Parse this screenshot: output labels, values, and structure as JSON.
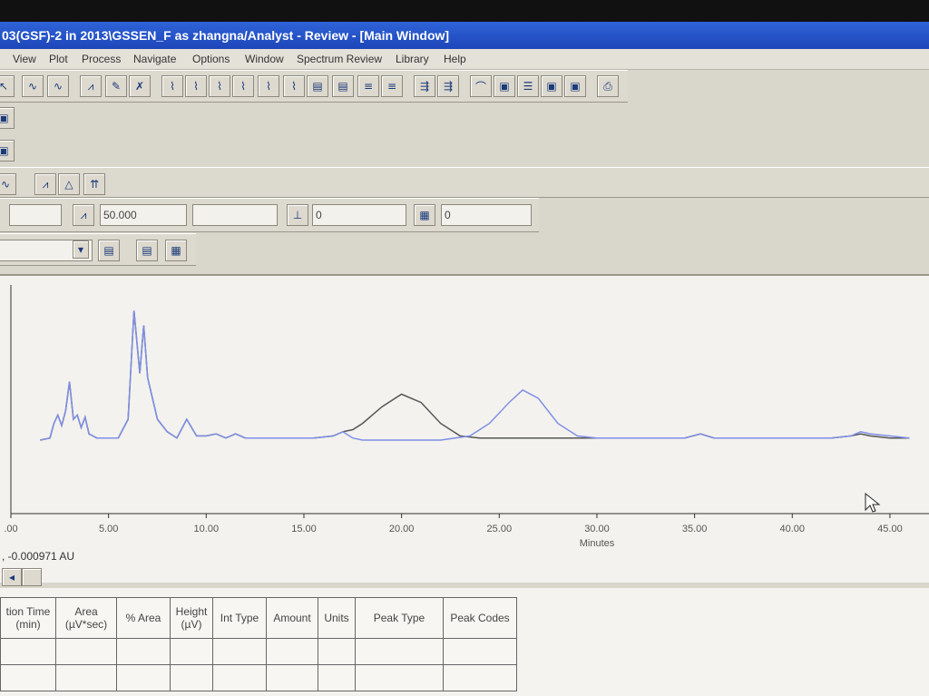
{
  "window": {
    "title": "03(GSF)-2 in 2013\\GSSEN_F as zhangna/Analyst - Review - [Main Window]"
  },
  "menu": [
    "View",
    "Plot",
    "Process",
    "Navigate",
    "Options",
    "Window",
    "Spectrum Review",
    "Library",
    "Help"
  ],
  "toolbar": {
    "icons": [
      "integrate-icon",
      "integrate-all-icon",
      "peak-add-icon",
      "peak-edit-icon",
      "peak-delete-icon",
      "spectrum-1-icon",
      "spectrum-2-icon",
      "spectrum-3-icon",
      "spectrum-4-icon",
      "spectrum-5-icon",
      "spectrum-6-icon",
      "spectrum-7-icon",
      "spectrum-8-icon",
      "spectrum-9-icon",
      "spectrum-10-icon",
      "tool-a-icon",
      "tool-b-icon",
      "view-1-icon",
      "view-2-icon",
      "view-3-icon",
      "view-4-icon",
      "view-5-icon",
      "print-icon"
    ]
  },
  "params": {
    "field1_value": "",
    "threshold_value": "50.000",
    "field3_value": "",
    "min_area_value": "0",
    "min_height_value": "0"
  },
  "plot": {
    "readout": ", -0.000971 AU"
  },
  "chart_data": {
    "type": "line",
    "xlabel": "Minutes",
    "ylabel": "",
    "xlim": [
      0,
      47
    ],
    "x_ticks": [
      ".00",
      "5.00",
      "10.00",
      "15.00",
      "20.00",
      "25.00",
      "30.00",
      "35.00",
      "40.00",
      "45.00"
    ],
    "x_tick_values": [
      0,
      5,
      10,
      15,
      20,
      25,
      30,
      35,
      40,
      45
    ],
    "series": [
      {
        "color": "#555555",
        "x": [
          1.5,
          2.0,
          2.2,
          2.4,
          2.6,
          2.8,
          3.0,
          3.2,
          3.4,
          3.6,
          3.8,
          4.0,
          4.2,
          4.4,
          4.6,
          5.0,
          5.5,
          6.0,
          6.3,
          6.6,
          6.8,
          7.0,
          7.2,
          7.5,
          8.0,
          8.5,
          9.0,
          9.5,
          10.0,
          10.5,
          11.0,
          11.5,
          12.0,
          14.0,
          15.5,
          16.5,
          17.0,
          17.5,
          18.0,
          19.0,
          20.0,
          21.0,
          22.0,
          23.0,
          24.0,
          25.0,
          27.0,
          30.0,
          33.0,
          34.5,
          35.3,
          36.0,
          38.0,
          40.0,
          42.0,
          43.0,
          43.5,
          44.0,
          45.0,
          46.0
        ],
        "y": [
          0,
          1,
          8,
          12,
          7,
          14,
          28,
          10,
          12,
          6,
          11,
          3,
          2,
          1,
          1,
          1,
          1,
          10,
          62,
          32,
          55,
          30,
          22,
          10,
          4,
          1,
          10,
          2,
          2,
          3,
          1,
          3,
          1,
          1,
          1,
          2,
          4,
          5,
          8,
          16,
          22,
          18,
          8,
          2,
          1,
          1,
          1,
          1,
          1,
          1,
          3,
          1,
          1,
          1,
          1,
          2,
          3,
          2,
          1,
          1
        ]
      },
      {
        "color": "#7f8fe6",
        "x": [
          1.5,
          2.0,
          2.2,
          2.4,
          2.6,
          2.8,
          3.0,
          3.2,
          3.4,
          3.6,
          3.8,
          4.0,
          4.2,
          4.4,
          4.6,
          5.0,
          5.5,
          6.0,
          6.3,
          6.6,
          6.8,
          7.0,
          7.2,
          7.5,
          8.0,
          8.5,
          9.0,
          9.5,
          10.0,
          10.5,
          11.0,
          11.5,
          12.0,
          14.0,
          15.5,
          16.5,
          17.0,
          17.5,
          18.0,
          20.0,
          22.0,
          23.5,
          24.5,
          25.5,
          26.2,
          27.0,
          28.0,
          29.0,
          30.0,
          33.0,
          34.5,
          35.3,
          36.0,
          38.0,
          40.0,
          42.0,
          43.0,
          43.5,
          44.0,
          45.0,
          46.0
        ],
        "y": [
          0,
          1,
          8,
          12,
          7,
          14,
          28,
          10,
          12,
          6,
          11,
          3,
          2,
          1,
          1,
          1,
          1,
          10,
          62,
          32,
          55,
          30,
          22,
          10,
          4,
          1,
          10,
          2,
          2,
          3,
          1,
          3,
          1,
          1,
          1,
          2,
          4,
          1,
          0,
          0,
          0,
          2,
          8,
          18,
          24,
          20,
          8,
          2,
          1,
          1,
          1,
          3,
          1,
          1,
          1,
          1,
          2,
          4,
          3,
          2,
          1
        ]
      }
    ]
  },
  "table": {
    "headers": [
      "tion Time\n(min)",
      "Area\n(µV*sec)",
      "% Area",
      "Height\n(µV)",
      "Int Type",
      "Amount",
      "Units",
      "Peak Type",
      "Peak Codes"
    ]
  }
}
